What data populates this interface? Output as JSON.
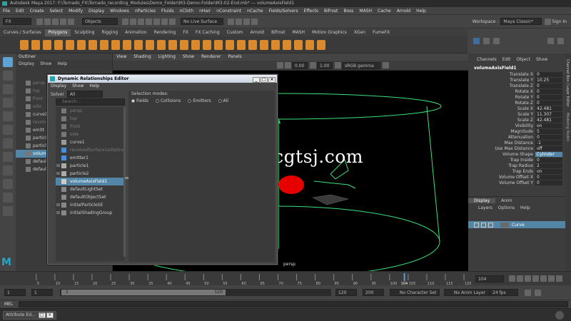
{
  "title_bar": {
    "text": "Autodesk Maya 2017: F:\\Tornado_FX\\Tornado_recording_Modules\\Demo_Folder\\M3-Demo-Folder\\M3-02-End.mb* --- volumeAxisField1"
  },
  "main_menu": [
    "File",
    "Edit",
    "Create",
    "Select",
    "Modify",
    "Display",
    "Windows",
    "nParticles",
    "Fluids",
    "nCloth",
    "nHair",
    "nConstraint",
    "nCache",
    "Fields/Solvers",
    "Effects",
    "Bifrost",
    "Boss",
    "MASH",
    "Cache",
    "Arnold",
    "Help"
  ],
  "status_line": {
    "menuset": "FX",
    "selection_mode": "Objects",
    "live_surface": "No Live Surface",
    "workspace_label": "Workspace :",
    "workspace_value": "Maya Classic*",
    "sign_in": "Sign In"
  },
  "shelf_tabs": [
    {
      "label": "Curves / Surfaces",
      "active": false
    },
    {
      "label": "Polygons",
      "active": true
    },
    {
      "label": "Sculpting",
      "active": false
    },
    {
      "label": "Rigging",
      "active": false
    },
    {
      "label": "Animation",
      "active": false
    },
    {
      "label": "Rendering",
      "active": false
    },
    {
      "label": "FX",
      "active": false
    },
    {
      "label": "FX Caching",
      "active": false
    },
    {
      "label": "Custom",
      "active": false
    },
    {
      "label": "Arnold",
      "active": false
    },
    {
      "label": "Bifrost",
      "active": false
    },
    {
      "label": "MASH",
      "active": false
    },
    {
      "label": "Motion Graphics",
      "active": false
    },
    {
      "label": "XGen",
      "active": false
    },
    {
      "label": "FumeFX",
      "active": false
    }
  ],
  "outliner": {
    "title": "Outliner",
    "menu": [
      "Display",
      "Show",
      "Help"
    ],
    "items": [
      {
        "label": "persp",
        "dim": true
      },
      {
        "label": "top",
        "dim": true
      },
      {
        "label": "front",
        "dim": true
      },
      {
        "label": "side",
        "dim": true
      },
      {
        "label": "curve1",
        "dim": false
      },
      {
        "label": "revolved",
        "dim": true
      },
      {
        "label": "emitt",
        "dim": false
      },
      {
        "label": "particl",
        "dim": false
      },
      {
        "label": "particl",
        "dim": false
      },
      {
        "label": "volum",
        "dim": false,
        "selected": true
      },
      {
        "label": "defaul",
        "dim": false
      },
      {
        "label": "defaul",
        "dim": false
      }
    ]
  },
  "viewport": {
    "menu": [
      "View",
      "Shading",
      "Lighting",
      "Show",
      "Renderer",
      "Panels"
    ],
    "exposure": "0.00",
    "gamma": "1.00",
    "color_space": "sRGB gamma",
    "camera": "persp",
    "watermark": "www.cgtsj.com"
  },
  "dre": {
    "title": "Dynamic Relationships Editor",
    "menu": [
      "Display",
      "Show",
      "Help"
    ],
    "solver_label": "Solver",
    "solver_value": "All",
    "search_placeholder": "Search...",
    "items": [
      {
        "label": "persp",
        "dim": true,
        "expand": false,
        "color": "#777"
      },
      {
        "label": "top",
        "dim": true,
        "expand": false,
        "color": "#777"
      },
      {
        "label": "front",
        "dim": true,
        "expand": false,
        "color": "#777"
      },
      {
        "label": "side",
        "dim": true,
        "expand": false,
        "color": "#777"
      },
      {
        "label": "curve1",
        "dim": false,
        "expand": false,
        "color": "#999"
      },
      {
        "label": "revolvedSurface1eliteline5ur",
        "dim": true,
        "expand": false,
        "color": "#4a8fd6"
      },
      {
        "label": "emitter1",
        "dim": false,
        "expand": false,
        "color": "#4a8fd6"
      },
      {
        "label": "particle1",
        "dim": false,
        "expand": true,
        "color": "#aaa"
      },
      {
        "label": "particle2",
        "dim": false,
        "expand": true,
        "color": "#aaa"
      },
      {
        "label": "volumeAxisField1",
        "dim": false,
        "expand": false,
        "color": "#ccc",
        "selected": true
      },
      {
        "label": "defaultLightSet",
        "dim": false,
        "expand": false,
        "color": "#888"
      },
      {
        "label": "defaultObjectSet",
        "dim": false,
        "expand": false,
        "color": "#888"
      },
      {
        "label": "initialParticleSE",
        "dim": false,
        "expand": true,
        "color": "#888"
      },
      {
        "label": "initialShadingGroup",
        "dim": false,
        "expand": true,
        "color": "#888"
      }
    ],
    "selection_modes_label": "Selection modes:",
    "modes": [
      {
        "label": "Fields",
        "on": true
      },
      {
        "label": "Collisions",
        "on": false
      },
      {
        "label": "Emitters",
        "on": false
      },
      {
        "label": "All",
        "on": false
      }
    ]
  },
  "channel_box": {
    "menu": [
      "Channels",
      "Edit",
      "Object",
      "Show"
    ],
    "object_name": "volumeAxisField1",
    "channels": [
      {
        "label": "Translate X",
        "value": "0"
      },
      {
        "label": "Translate Y",
        "value": "10.25"
      },
      {
        "label": "Translate Z",
        "value": "0"
      },
      {
        "label": "Rotate X",
        "value": "0"
      },
      {
        "label": "Rotate Y",
        "value": "0"
      },
      {
        "label": "Rotate Z",
        "value": "0"
      },
      {
        "label": "Scale X",
        "value": "42.481"
      },
      {
        "label": "Scale Y",
        "value": "11.307"
      },
      {
        "label": "Scale Z",
        "value": "42.481"
      },
      {
        "label": "Visibility",
        "value": "on"
      },
      {
        "label": "Magnitude",
        "value": "5"
      },
      {
        "label": "Attenuation",
        "value": "0"
      },
      {
        "label": "Max Distance",
        "value": "-1"
      },
      {
        "label": "Use Max Distance",
        "value": "off"
      },
      {
        "label": "Volume Shape",
        "value": "Cylinder",
        "highlight": true
      },
      {
        "label": "Trap Inside",
        "value": "0"
      },
      {
        "label": "Trap Radius",
        "value": "2"
      },
      {
        "label": "Trap Ends",
        "value": "on"
      },
      {
        "label": "Volume Offset X",
        "value": "0"
      },
      {
        "label": "Volume Offset Y",
        "value": "0"
      }
    ],
    "side_tabs": [
      "Channel Box / Layer Editor",
      "Modeling Toolkit",
      "Attribute Editor"
    ]
  },
  "layer_editor": {
    "tabs": [
      "Display",
      "Anim"
    ],
    "menu": [
      "Layers",
      "Options",
      "Help"
    ],
    "layer_name": "Curve"
  },
  "time_slider": {
    "ticks": [
      "5",
      "10",
      "15",
      "20",
      "25",
      "30",
      "35",
      "40",
      "45",
      "50",
      "55",
      "60",
      "65",
      "70",
      "75",
      "80",
      "85",
      "90",
      "95",
      "100",
      "105",
      "110",
      "115",
      "120"
    ],
    "current_frame": "104",
    "current_frame_field": "104"
  },
  "range_slider": {
    "start": "1",
    "playback_start": "1",
    "range_start_marker": "1",
    "range_end_marker": "120",
    "playback_end": "120",
    "end": "200",
    "character_set": "No Character Set",
    "anim_layer": "No Anim Layer",
    "fps": "24 fps"
  },
  "command_line": {
    "label": "MEL"
  },
  "taskbar": {
    "attribute_editor": "Attribute Ed..."
  }
}
